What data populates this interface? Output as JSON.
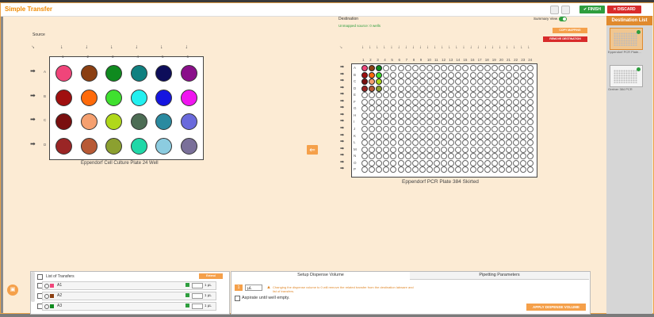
{
  "app": {
    "title": "Simple Transfer",
    "finish": "✔ FINISH",
    "discard": "✕ DISCARD"
  },
  "source": {
    "label": "Source",
    "plate_name": "Eppendorf Cell Culture Plate 24 Well",
    "cols": [
      "1",
      "2",
      "3",
      "4",
      "5",
      "6"
    ],
    "rows": [
      "A",
      "B",
      "C",
      "D"
    ],
    "wells": [
      [
        "#f0457a",
        "#8b3f12",
        "#0f8a1f",
        "#0f8080",
        "#0d0d5a",
        "#8a0f8a"
      ],
      [
        "#a00f0f",
        "#ff6a0a",
        "#3fe02f",
        "#22f0f0",
        "#1515e0",
        "#f015f0"
      ],
      [
        "#7a0f0f",
        "#f5a070",
        "#b0d81a",
        "#4d6d55",
        "#2a8aa0",
        "#6a6adc"
      ],
      [
        "#9a2525",
        "#b85a35",
        "#8ca030",
        "#20d8a8",
        "#8ccce0",
        "#7a709a"
      ]
    ]
  },
  "destination": {
    "label": "Destination",
    "unmapped": "Unmapped source: 0 wells",
    "summary_view": "Summary View",
    "copy_mapping": "COPY MAPPING",
    "remove_destination": "REMOVE DESTINATION",
    "plate_name": "Eppendorf PCR Plate 384 Skirted",
    "cols": [
      "1",
      "2",
      "3",
      "4",
      "5",
      "6",
      "7",
      "8",
      "9",
      "10",
      "11",
      "12",
      "13",
      "14",
      "15",
      "16",
      "17",
      "18",
      "19",
      "20",
      "21",
      "22",
      "23",
      "24"
    ],
    "rows": [
      "A",
      "B",
      "C",
      "D",
      "E",
      "F",
      "G",
      "H",
      "I",
      "J",
      "K",
      "L",
      "M",
      "N",
      "O",
      "P"
    ],
    "filled": [
      [
        "#f0457a",
        "#8b3f12",
        "#0f8a1f"
      ],
      [
        "#a00f0f",
        "#ff6a0a",
        "#3fe02f"
      ],
      [
        "#7a0f0f",
        "#f5a070",
        "#b0d81a"
      ],
      [
        "#9a2525",
        "#b85a35",
        "#8ca030"
      ]
    ]
  },
  "sidebar": {
    "title": "Destination List",
    "items": [
      {
        "label": "Eppendorf PCR Plate..."
      },
      {
        "label": "Greiner 384 PCR"
      }
    ]
  },
  "transfers": {
    "title": "List of Transfers",
    "expand": "Extend",
    "rows": [
      {
        "well": "A1",
        "color": "#f0457a",
        "vol": "1 µL"
      },
      {
        "well": "A2",
        "color": "#8b3f12",
        "vol": "1 µL"
      },
      {
        "well": "A3",
        "color": "#0f8a1f",
        "vol": "1 µL"
      }
    ]
  },
  "dispense": {
    "tab1": "Setup Dispense Volume",
    "tab2": "Pipetting Parameters",
    "value": "1",
    "unit": "µL",
    "warning": "Changing the dispense volume to 0 will remove the related transfer from the destination labware and list of transfers.",
    "aspirate": "Aspirate until well empty.",
    "apply": "APPLY DISPENSE VOLUME"
  }
}
